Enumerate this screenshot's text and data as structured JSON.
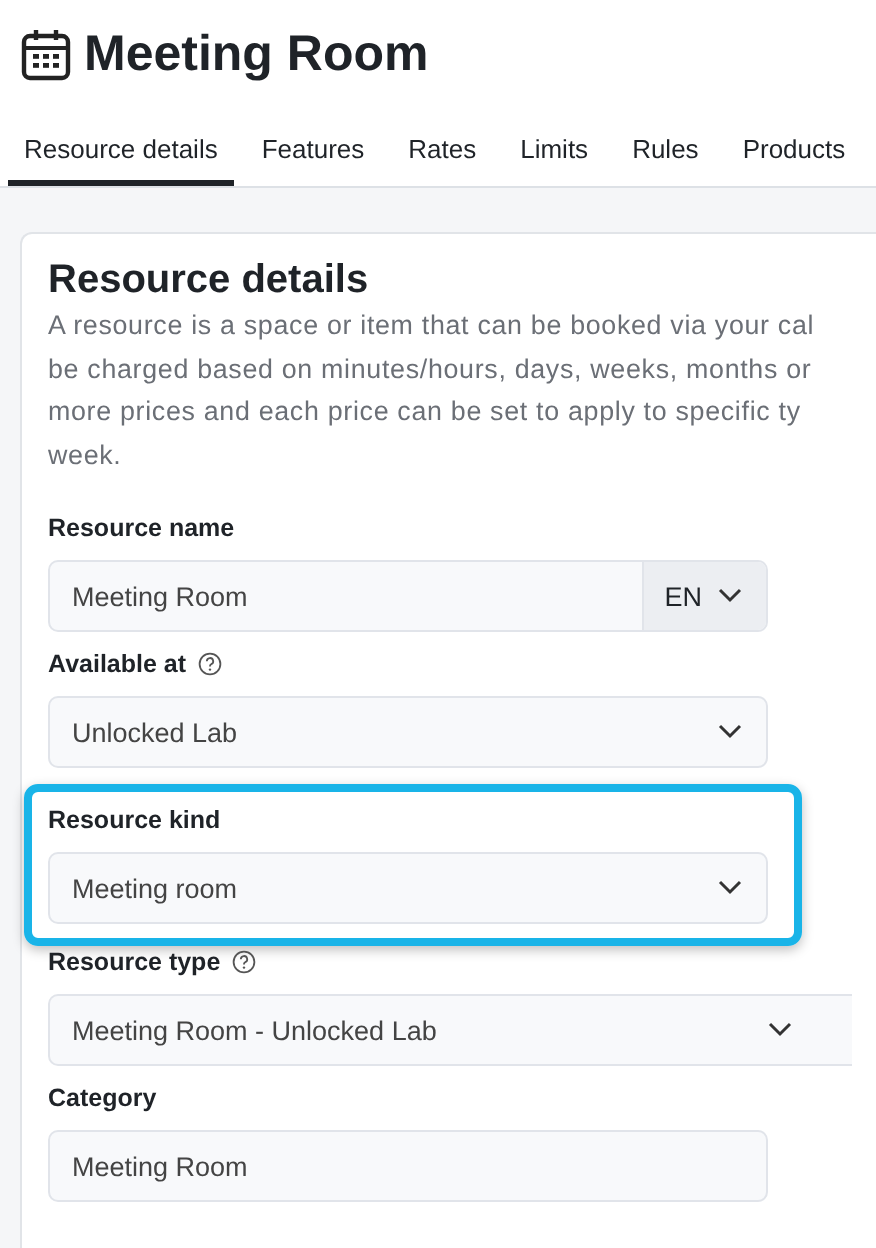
{
  "page": {
    "title": "Meeting Room"
  },
  "tabs": [
    {
      "label": "Resource details",
      "selected": true
    },
    {
      "label": "Features",
      "selected": false
    },
    {
      "label": "Rates",
      "selected": false
    },
    {
      "label": "Limits",
      "selected": false
    },
    {
      "label": "Rules",
      "selected": false
    },
    {
      "label": "Products",
      "selected": false
    }
  ],
  "card": {
    "heading": "Resource details",
    "description": "A resource is a space or item that can be booked via your cal\nbe charged based on minutes/hours, days, weeks, months or\nmore prices and each price can be set to apply to specific ty\nweek.",
    "fields": [
      {
        "kind": "language-text",
        "label": "Resource name",
        "value": "Meeting Room",
        "language": "EN",
        "help": false,
        "highlighted": false
      },
      {
        "kind": "select",
        "label": "Available at",
        "value": "Unlocked Lab",
        "help": true,
        "highlighted": false
      },
      {
        "kind": "select",
        "label": "Resource kind",
        "value": "Meeting room",
        "help": false,
        "highlighted": true
      },
      {
        "kind": "wide-select",
        "label": "Resource type",
        "value": "Meeting Room - Unlocked Lab",
        "help": true,
        "highlighted": false
      },
      {
        "kind": "text",
        "label": "Category",
        "value": "Meeting Room",
        "help": false,
        "highlighted": false
      }
    ]
  }
}
